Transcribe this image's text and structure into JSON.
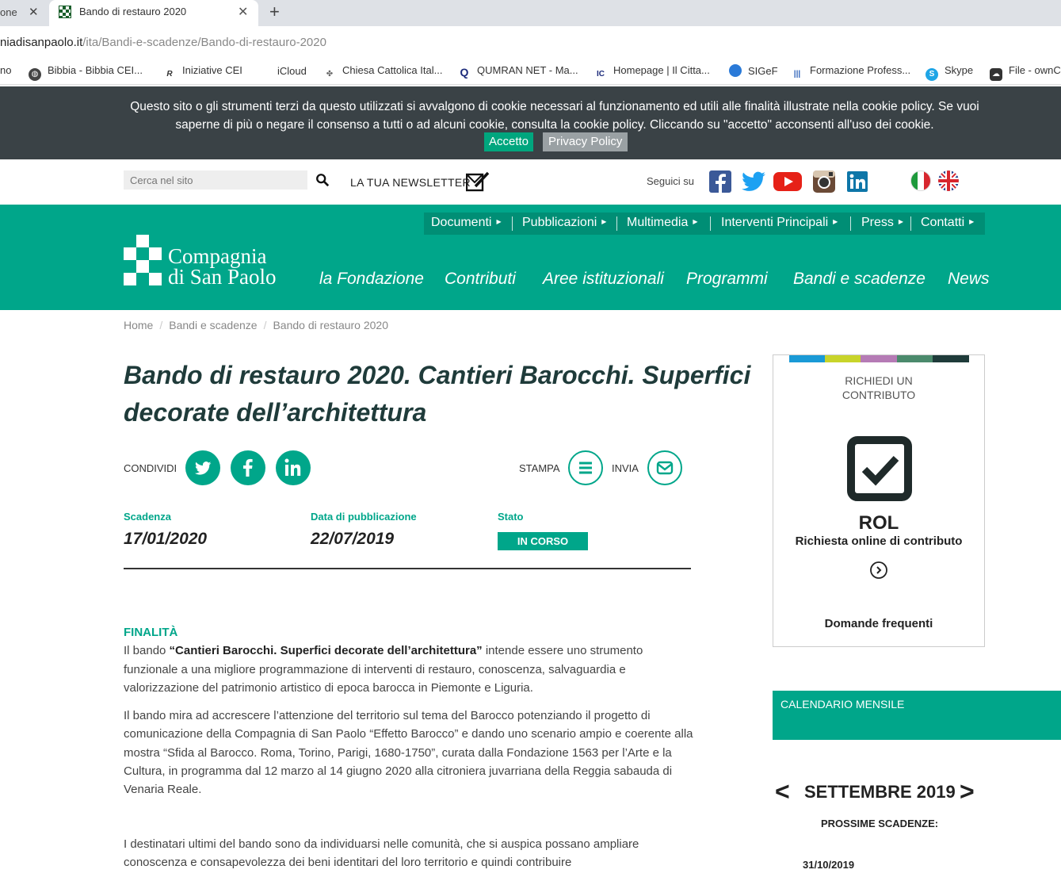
{
  "browser": {
    "prev_tab_label": "one",
    "active_tab_label": "Bando di restauro 2020",
    "url_host": "niadisanpaolo.it",
    "url_path": "/ita/Bandi-e-scadenze/Bando-di-restauro-2020",
    "bookmarks": [
      "no",
      "Bibbia - Bibbia CEI...",
      "Iniziative CEI",
      "iCloud",
      "Chiesa Cattolica Ital...",
      "QUMRAN NET - Ma...",
      "Homepage | Il Citta...",
      "SIGeF",
      "Formazione Profess...",
      "Skype",
      "File - ownC"
    ]
  },
  "cookie": {
    "message": "Questo sito o gli strumenti terzi da questo utilizzati si avvalgono di cookie necessari al funzionamento ed utili alle finalità illustrate nella cookie policy. Se vuoi saperne di più o negare il consenso a tutti o ad alcuni cookie, consulta la cookie policy. Cliccando su \"accetto\" acconsenti all'uso dei cookie.",
    "accept": "Accetto",
    "privacy": "Privacy Policy"
  },
  "utility": {
    "search_placeholder": "Cerca nel sito",
    "newsletter": "LA TUA NEWSLETTER",
    "follow": "Seguici su"
  },
  "topmenu": [
    "Documenti",
    "Pubblicazioni",
    "Multimedia",
    "Interventi Principali",
    "Press",
    "Contatti"
  ],
  "logo": {
    "line1": "Compagnia",
    "line2": "di San Paolo"
  },
  "mainnav": [
    "la Fondazione",
    "Contributi",
    "Aree istituzionali",
    "Programmi",
    "Bandi e scadenze",
    "News"
  ],
  "breadcrumb": [
    "Home",
    "Bandi e scadenze",
    "Bando di restauro 2020"
  ],
  "title": "Bando di restauro 2020. Cantieri Barocchi. Superfici decorate dell’architettura",
  "share": {
    "label": "CONDIVIDI",
    "print": "STAMPA",
    "send": "INVIA"
  },
  "meta": {
    "deadline_label": "Scadenza",
    "deadline": "17/01/2020",
    "published_label": "Data di pubblicazione",
    "published": "22/07/2019",
    "status_label": "Stato",
    "status": "IN CORSO"
  },
  "body": {
    "heading": "FINALITÀ",
    "p1_pre": "Il bando ",
    "p1_bold": "“Cantieri Barocchi. Superfici decorate dell’architettura”",
    "p1_post": " intende essere uno strumento funzionale a una migliore programmazione di interventi di restauro, conoscenza, salvaguardia e valorizzazione del patrimonio artistico di epoca barocca in Piemonte e Liguria.",
    "p2": "Il bando mira ad accrescere l’attenzione del territorio sul tema del Barocco potenziando il progetto di comunicazione della Compagnia di San Paolo “Effetto Barocco” e dando uno scenario ampio e coerente alla mostra “Sfida al Barocco. Roma, Torino, Parigi, 1680-1750”, curata dalla Fondazione 1563 per l’Arte e la Cultura, in programma dal 12 marzo al 14 giugno 2020 alla citroniera juvarriana della Reggia sabauda di Venaria Reale.",
    "p3": "I destinatari ultimi del bando sono da individuarsi nelle comunità, che si auspica possano ampliare conoscenza e consapevolezza dei beni identitari del loro territorio e quindi contribuire"
  },
  "sidebar": {
    "rol_sub": "RICHIEDI UN CONTRIBUTO",
    "rol_title": "ROL",
    "rol_desc": "Richiesta online di contributo",
    "faq": "Domande frequenti",
    "stripe_colors": [
      "#1a9ad6",
      "#c8d42a",
      "#b57bb5",
      "#4b8a6c",
      "#1f3b3a"
    ],
    "calendar_title": "CALENDARIO MENSILE",
    "calendar_month": "SETTEMBRE 2019",
    "next_deadlines": "PROSSIME SCADENZE:",
    "next_date": "31/10/2019"
  },
  "colors": {
    "brand": "#00a68a",
    "brand_dark": "#008e75",
    "cookie_bg": "#3a4246"
  }
}
